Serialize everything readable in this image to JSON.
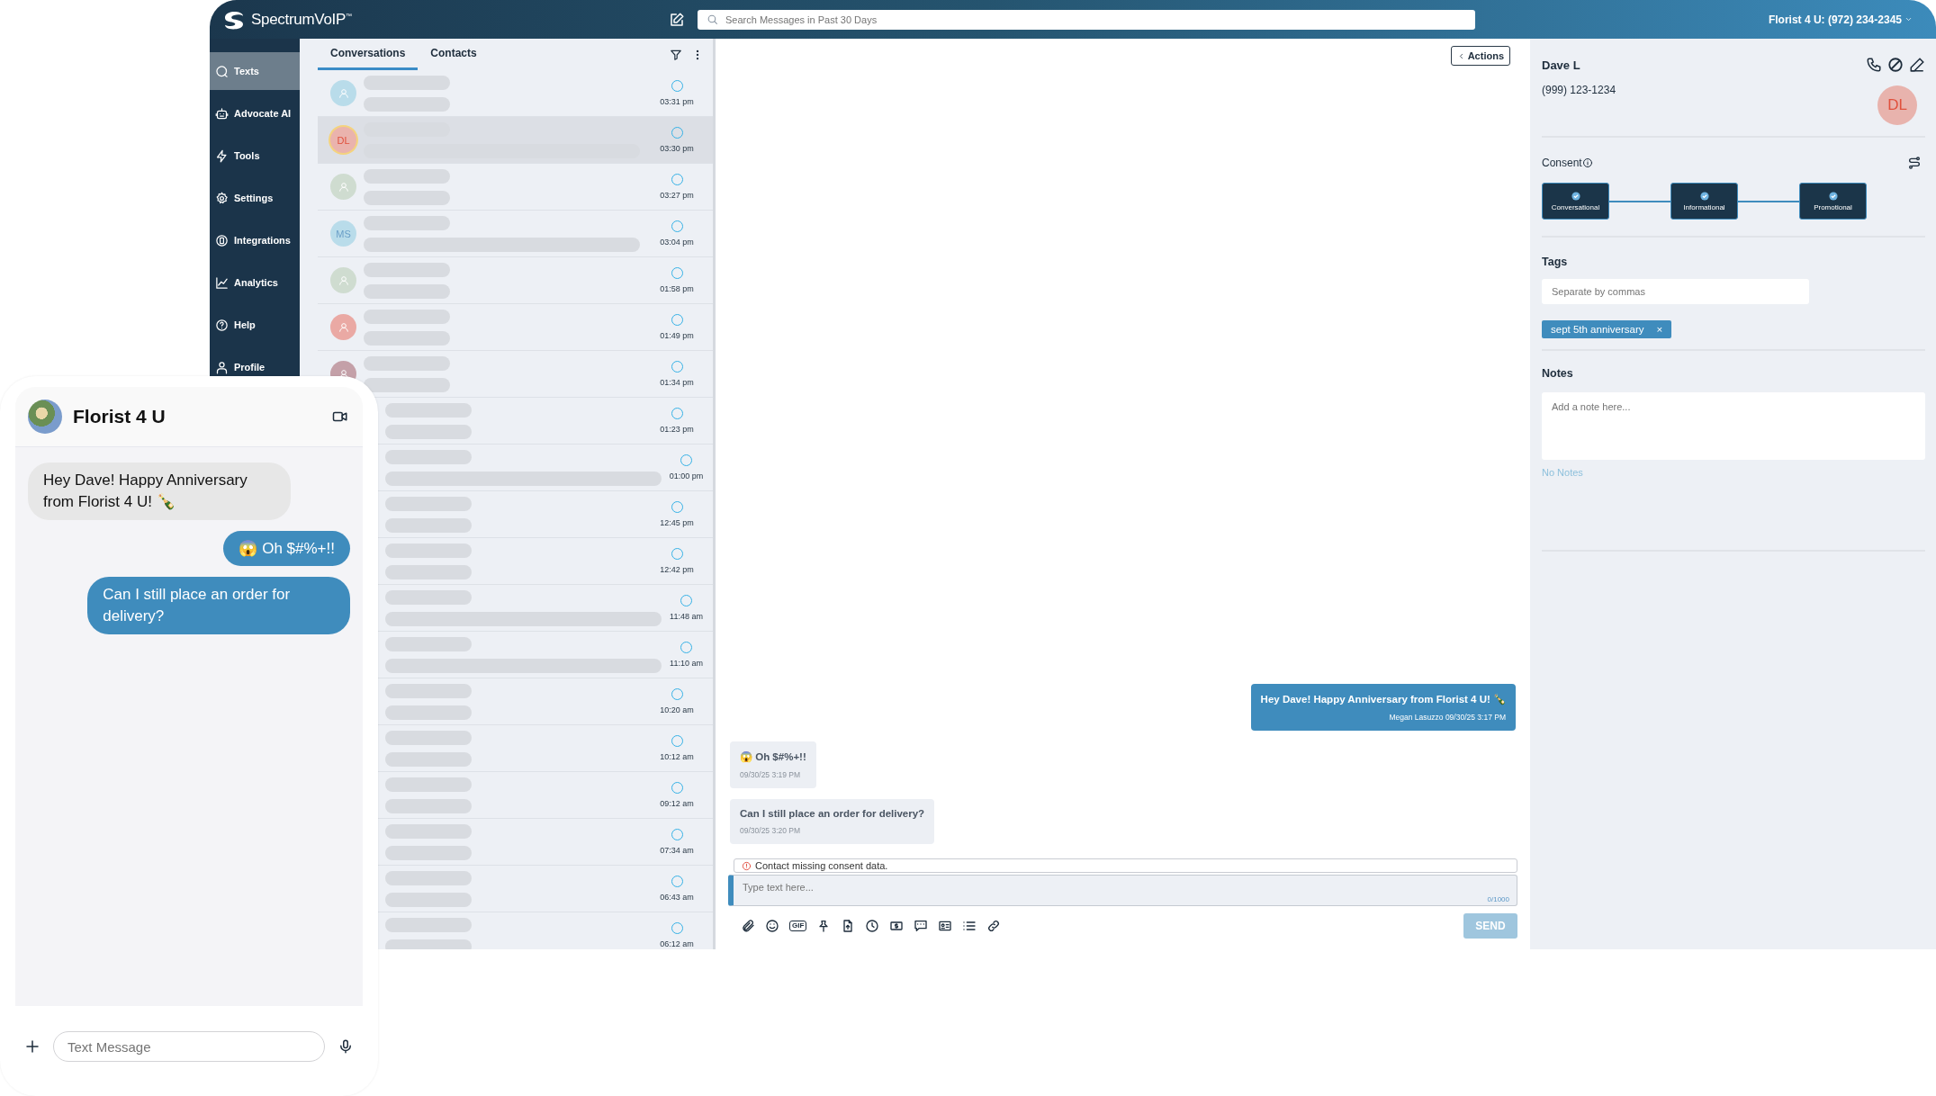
{
  "topbar": {
    "brand": "SpectrumVoIP",
    "brand_mark": "™",
    "search": {
      "placeholder": "Search Messages in Past 30 Days"
    },
    "account": "Florist 4 U: (972) 234-2345"
  },
  "sidebar": {
    "items": [
      {
        "label": "Texts",
        "selected": true
      },
      {
        "label": "Advocate AI",
        "selected": false
      },
      {
        "label": "Tools",
        "selected": false
      },
      {
        "label": "Settings",
        "selected": false
      },
      {
        "label": "Integrations",
        "selected": false
      },
      {
        "label": "Analytics",
        "selected": false
      },
      {
        "label": "Help",
        "selected": false
      },
      {
        "label": "Profile",
        "selected": false
      }
    ]
  },
  "conversations": {
    "tabs": [
      {
        "label": "Conversations",
        "selected": true
      },
      {
        "label": "Contacts",
        "selected": false
      }
    ],
    "rows": [
      {
        "time": "03:31 pm",
        "selected": false,
        "preview_long": false,
        "avatar": {
          "kind": "person",
          "color": "#b9dcea"
        }
      },
      {
        "time": "03:30 pm",
        "selected": true,
        "preview_long": true,
        "avatar": {
          "kind": "initials",
          "initials": "DL",
          "color": "#eab3ad"
        }
      },
      {
        "time": "03:27 pm",
        "selected": false,
        "preview_long": false,
        "avatar": {
          "kind": "person",
          "color": "#cfdcd0"
        }
      },
      {
        "time": "03:04 pm",
        "selected": false,
        "preview_long": true,
        "avatar": {
          "kind": "initials",
          "initials": "MS",
          "color": "#b9dcea"
        }
      },
      {
        "time": "01:58 pm",
        "selected": false,
        "preview_long": false,
        "avatar": {
          "kind": "person",
          "color": "#cfdcd0"
        }
      },
      {
        "time": "01:49 pm",
        "selected": false,
        "preview_long": false,
        "avatar": {
          "kind": "person",
          "color": "#eaa9a4"
        }
      },
      {
        "time": "01:34 pm",
        "selected": false,
        "preview_long": false,
        "avatar": {
          "kind": "person",
          "color": "#c4a0a8"
        }
      },
      {
        "time": "01:23 pm",
        "selected": false,
        "preview_long": false
      },
      {
        "time": "01:00 pm",
        "selected": false,
        "preview_long": true
      },
      {
        "time": "12:45 pm",
        "selected": false,
        "preview_long": false
      },
      {
        "time": "12:42 pm",
        "selected": false,
        "preview_long": false
      },
      {
        "time": "11:48 am",
        "selected": false,
        "preview_long": true
      },
      {
        "time": "11:10 am",
        "selected": false,
        "preview_long": true
      },
      {
        "time": "10:20 am",
        "selected": false,
        "preview_long": false
      },
      {
        "time": "10:12 am",
        "selected": false,
        "preview_long": false
      },
      {
        "time": "09:12 am",
        "selected": false,
        "preview_long": false
      },
      {
        "time": "07:34 am",
        "selected": false,
        "preview_long": false
      },
      {
        "time": "06:43 am",
        "selected": false,
        "preview_long": false
      },
      {
        "time": "06:12 am",
        "selected": false,
        "preview_long": false
      }
    ]
  },
  "chat": {
    "actions_button": "Actions",
    "messages": [
      {
        "kind": "outgoing",
        "text": "Hey Dave! Happy Anniversary from Florist 4 U! 🍾",
        "meta": "Megan Lasuzzo 09/30/25 3:17 PM"
      },
      {
        "kind": "incoming",
        "text": "😱 Oh $#%+!!",
        "meta": "09/30/25 3:19 PM"
      },
      {
        "kind": "incoming",
        "text": "Can I still place an order for delivery?",
        "meta": "09/30/25 3:20 PM"
      }
    ],
    "warning": "Contact missing consent data.",
    "composer": {
      "placeholder": "Type text here...",
      "counter": "0/1000"
    },
    "gif_label": "GIF",
    "send_button": "SEND"
  },
  "contact": {
    "name": "Dave L",
    "phone": "(999) 123-1234",
    "initials": "DL",
    "consent": {
      "label": "Consent",
      "items": [
        {
          "label": "Conversational",
          "checked": true
        },
        {
          "label": "Informational",
          "checked": true
        },
        {
          "label": "Promotional",
          "checked": true
        }
      ]
    },
    "tags": {
      "label": "Tags",
      "placeholder": "Separate by commas",
      "items": [
        {
          "label": "sept 5th anniversary",
          "remove": "×"
        }
      ]
    },
    "notes": {
      "label": "Notes",
      "placeholder": "Add a note here...",
      "empty": "No Notes"
    }
  },
  "phone": {
    "title": "Florist 4 U",
    "messages": [
      {
        "kind": "incoming",
        "text": "Hey Dave! Happy Anniversary from Florist 4 U! 🍾"
      },
      {
        "kind": "outgoing",
        "text": "😱 Oh $#%+!!"
      },
      {
        "kind": "outgoing",
        "text": "Can I still place an order for delivery?"
      }
    ],
    "input": {
      "placeholder": "Text Message"
    }
  }
}
